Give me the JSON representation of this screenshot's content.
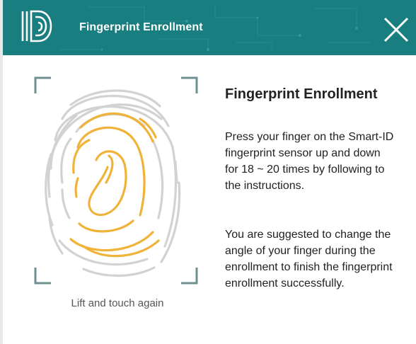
{
  "window": {
    "title": "Fingerprint Enrollment"
  },
  "colors": {
    "titlebar": "#187e80",
    "accent_ridges": "#f0b33a",
    "gray_ridges": "#cfcfcf",
    "corner_brackets": "#6f8f91"
  },
  "icons": {
    "logo": "smart-id-logo",
    "close": "close-x-icon",
    "fingerprint": "fingerprint-icon"
  },
  "scan": {
    "caption": "Lift and touch again"
  },
  "info": {
    "heading": "Fingerprint Enrollment",
    "paragraph1": "Press your finger on the Smart-ID fingerprint sensor up and down for 18 ~ 20 times by following to the instructions.",
    "paragraph2": "You are suggested to change the angle of your finger during the enrollment to finish the fingerprint enrollment successfully."
  }
}
